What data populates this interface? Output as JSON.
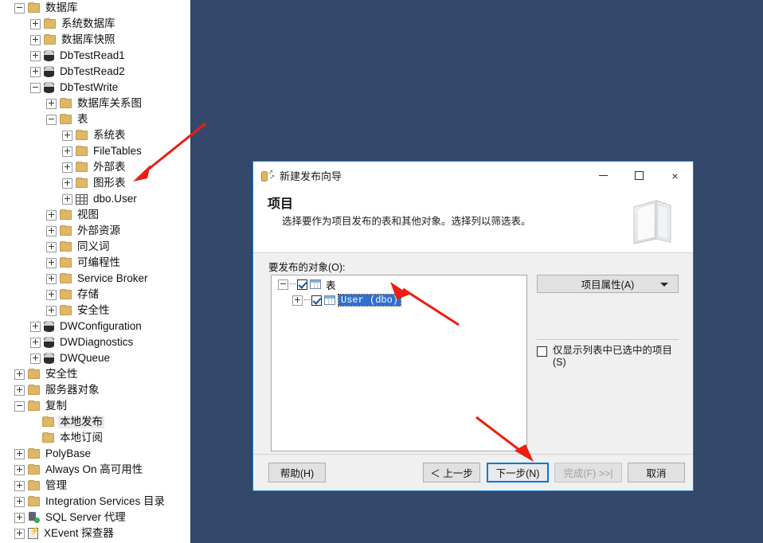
{
  "theme": {
    "desktop_bg": "#34486b",
    "accent": "#0078d7",
    "folder": "#e0b667",
    "selection": "#2f6fd0",
    "arrow": "#ee1c12"
  },
  "explorer": {
    "nodes": [
      {
        "depth": 0,
        "exp": "minus",
        "icon": "folder",
        "label": "数据库"
      },
      {
        "depth": 1,
        "exp": "plus",
        "icon": "folder",
        "label": "系统数据库"
      },
      {
        "depth": 1,
        "exp": "plus",
        "icon": "folder",
        "label": "数据库快照"
      },
      {
        "depth": 1,
        "exp": "plus",
        "icon": "db",
        "label": "DbTestRead1"
      },
      {
        "depth": 1,
        "exp": "plus",
        "icon": "db",
        "label": "DbTestRead2"
      },
      {
        "depth": 1,
        "exp": "minus",
        "icon": "db",
        "label": "DbTestWrite"
      },
      {
        "depth": 2,
        "exp": "plus",
        "icon": "folder",
        "label": "数据库关系图"
      },
      {
        "depth": 2,
        "exp": "minus",
        "icon": "folder",
        "label": "表"
      },
      {
        "depth": 3,
        "exp": "plus",
        "icon": "folder",
        "label": "系统表"
      },
      {
        "depth": 3,
        "exp": "plus",
        "icon": "folder",
        "label": "FileTables"
      },
      {
        "depth": 3,
        "exp": "plus",
        "icon": "folder",
        "label": "外部表"
      },
      {
        "depth": 3,
        "exp": "plus",
        "icon": "folder",
        "label": "图形表"
      },
      {
        "depth": 3,
        "exp": "plus",
        "icon": "table",
        "label": "dbo.User"
      },
      {
        "depth": 2,
        "exp": "plus",
        "icon": "folder",
        "label": "视图"
      },
      {
        "depth": 2,
        "exp": "plus",
        "icon": "folder",
        "label": "外部资源"
      },
      {
        "depth": 2,
        "exp": "plus",
        "icon": "folder",
        "label": "同义词"
      },
      {
        "depth": 2,
        "exp": "plus",
        "icon": "folder",
        "label": "可编程性"
      },
      {
        "depth": 2,
        "exp": "plus",
        "icon": "folder",
        "label": "Service Broker"
      },
      {
        "depth": 2,
        "exp": "plus",
        "icon": "folder",
        "label": "存储"
      },
      {
        "depth": 2,
        "exp": "plus",
        "icon": "folder",
        "label": "安全性"
      },
      {
        "depth": 1,
        "exp": "plus",
        "icon": "db",
        "label": "DWConfiguration"
      },
      {
        "depth": 1,
        "exp": "plus",
        "icon": "db",
        "label": "DWDiagnostics"
      },
      {
        "depth": 1,
        "exp": "plus",
        "icon": "db",
        "label": "DWQueue"
      },
      {
        "depth": 0,
        "exp": "plus",
        "icon": "folder",
        "label": "安全性"
      },
      {
        "depth": 0,
        "exp": "plus",
        "icon": "folder",
        "label": "服务器对象"
      },
      {
        "depth": 0,
        "exp": "minus",
        "icon": "folder",
        "label": "复制"
      },
      {
        "depth": 1,
        "exp": "none",
        "icon": "folder",
        "label": "本地发布",
        "selected": true
      },
      {
        "depth": 1,
        "exp": "none",
        "icon": "folder",
        "label": "本地订阅"
      },
      {
        "depth": 0,
        "exp": "plus",
        "icon": "folder",
        "label": "PolyBase"
      },
      {
        "depth": 0,
        "exp": "plus",
        "icon": "folder",
        "label": "Always On 高可用性"
      },
      {
        "depth": 0,
        "exp": "plus",
        "icon": "folder",
        "label": "管理"
      },
      {
        "depth": 0,
        "exp": "plus",
        "icon": "folder",
        "label": "Integration Services 目录"
      },
      {
        "depth": 0,
        "exp": "plus",
        "icon": "agent",
        "label": "SQL Server 代理"
      },
      {
        "depth": 0,
        "exp": "plus",
        "icon": "xevent",
        "label": "XEvent 探查器"
      }
    ]
  },
  "dialog": {
    "title": "新建发布向导",
    "title_icon": "publication-icon",
    "window_controls": {
      "minimize": "minimize-icon",
      "maximize": "maximize-icon",
      "close": "×"
    },
    "banner": {
      "heading": "项目",
      "subtext": "选择要作为项目发布的表和其他对象。选择列以筛选表。"
    },
    "objects_label": "要发布的对象(O):",
    "tree": [
      {
        "depth": 0,
        "exp": "minus",
        "checked": true,
        "label": "表",
        "selected": false
      },
      {
        "depth": 1,
        "exp": "plus",
        "checked": true,
        "label": "User (dbo)",
        "selected": true
      }
    ],
    "properties_button": "项目属性(A)",
    "filter_checkbox": {
      "label": "仅显示列表中已选中的项目(S)",
      "checked": false
    },
    "buttons": {
      "help": "帮助(H)",
      "back": "＜ 上一步",
      "next": "下一步(N)",
      "finish": "完成(F) >>|",
      "cancel": "取消"
    }
  }
}
